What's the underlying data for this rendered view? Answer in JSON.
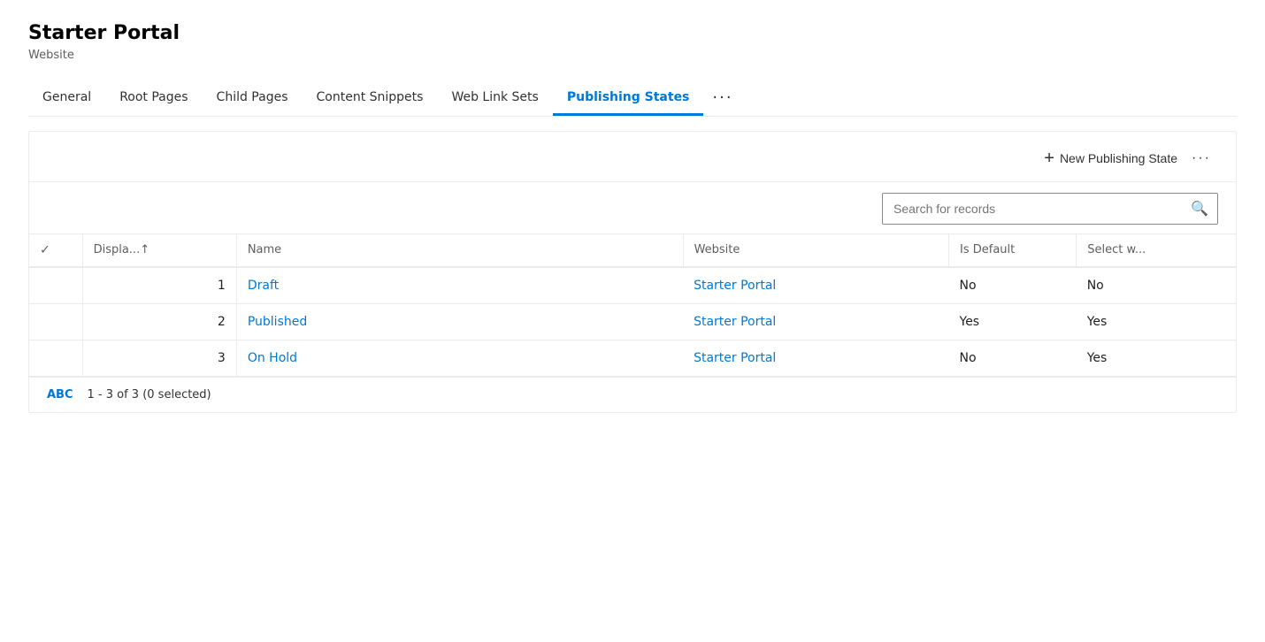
{
  "page": {
    "title": "Starter Portal",
    "subtitle": "Website"
  },
  "tabs": {
    "items": [
      {
        "id": "general",
        "label": "General",
        "active": false
      },
      {
        "id": "root-pages",
        "label": "Root Pages",
        "active": false
      },
      {
        "id": "child-pages",
        "label": "Child Pages",
        "active": false
      },
      {
        "id": "content-snippets",
        "label": "Content Snippets",
        "active": false
      },
      {
        "id": "web-link-sets",
        "label": "Web Link Sets",
        "active": false
      },
      {
        "id": "publishing-states",
        "label": "Publishing States",
        "active": true
      }
    ],
    "more": "···"
  },
  "toolbar": {
    "new_button_plus": "+",
    "new_button_label": "New Publishing State",
    "more_label": "···"
  },
  "search": {
    "placeholder": "Search for records"
  },
  "table": {
    "columns": {
      "display": "Displa...↑",
      "name": "Name",
      "website": "Website",
      "is_default": "Is Default",
      "select_w": "Select w..."
    },
    "rows": [
      {
        "num": "1",
        "name": "Draft",
        "website": "Starter Portal",
        "is_default": "No",
        "select_w": "No"
      },
      {
        "num": "2",
        "name": "Published",
        "website": "Starter Portal",
        "is_default": "Yes",
        "select_w": "Yes"
      },
      {
        "num": "3",
        "name": "On Hold",
        "website": "Starter Portal",
        "is_default": "No",
        "select_w": "Yes"
      }
    ]
  },
  "footer": {
    "alpha": "ABC",
    "count": "1 - 3 of 3 (0 selected)"
  }
}
